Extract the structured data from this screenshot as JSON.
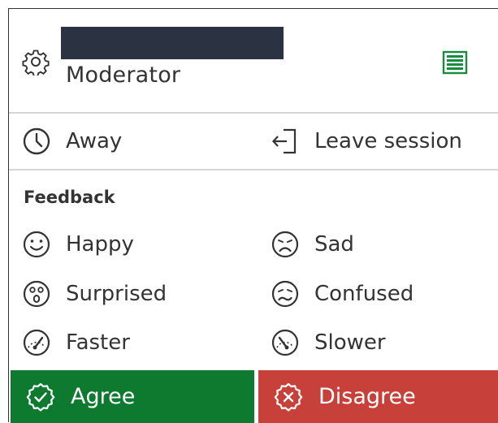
{
  "header": {
    "user_name": "",
    "role": "Moderator",
    "icons": {
      "settings": "gear-icon",
      "list": "list-icon"
    },
    "list_icon_color": "#1a8a3c"
  },
  "status": {
    "away_label": "Away",
    "leave_label": "Leave session"
  },
  "feedback": {
    "title": "Feedback",
    "items": [
      {
        "label": "Happy",
        "icon": "happy-face-icon"
      },
      {
        "label": "Sad",
        "icon": "sad-face-icon"
      },
      {
        "label": "Surprised",
        "icon": "surprised-face-icon"
      },
      {
        "label": "Confused",
        "icon": "confused-face-icon"
      },
      {
        "label": "Faster",
        "icon": "speedometer-fast-icon"
      },
      {
        "label": "Slower",
        "icon": "speedometer-slow-icon"
      }
    ],
    "agree_label": "Agree",
    "disagree_label": "Disagree",
    "agree_color": "#0d7a2f",
    "disagree_color": "#c8403a"
  }
}
